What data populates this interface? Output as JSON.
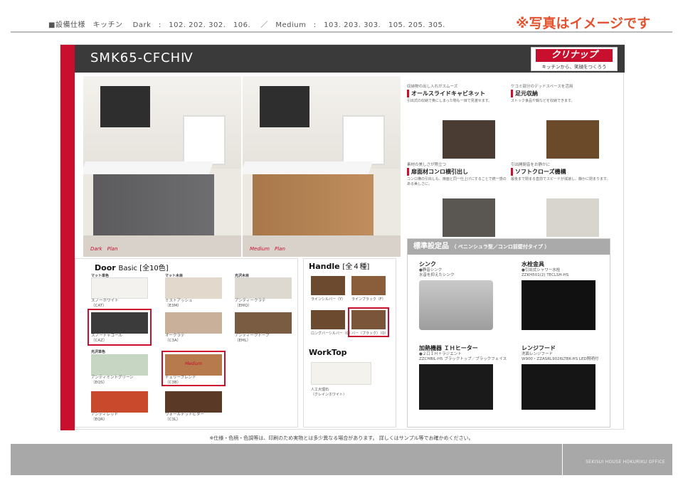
{
  "header": {
    "spec": "■設備仕様　キッチン　 Dark　:　102. 202. 302.　106.　 ／　Medium　:　103. 203. 303.　105. 205. 305.",
    "note": "※写真はイメージです"
  },
  "sheet": {
    "title": "SMK65-CFCHⅣ",
    "logo_text": "クリナップ",
    "logo_tagline": "キッチンから、笑顔をつくろう",
    "plan_dark": "Dark　Plan",
    "plan_medium": "Medium　Plan"
  },
  "features": [
    {
      "tag": "収納物の出し入れがスムーズ",
      "title": "オールスライドキャビネット",
      "desc": "引出式の収納で奥にしまった物も一目で見渡せます。"
    },
    {
      "tag": "ケコミ部分のデッドスペースを活用",
      "title": "足元収納",
      "desc": "ストック食品や鍋などを収納できます。"
    },
    {
      "tag": "素材の美しさが際立つ",
      "title": "扉面材コンロ横引出し",
      "desc": "コンロ横の引出しも、扉面と同一仕上げにすることで統一感のある美しさに。"
    },
    {
      "tag": "引出開閉音をお静かに",
      "title": "ソフトクローズ機構",
      "desc": "最後まで閉まる直前でスピードが減速し、静かに閉まります。"
    }
  ],
  "standard": {
    "heading": "標準設定品",
    "subheading": "（ ペニンシュラ型／コンロ前壁付タイプ ）",
    "sink": {
      "title": "シンク",
      "name": "●静音シンク",
      "desc": "水音を抑えたシンク"
    },
    "faucet": {
      "title": "水栓金具",
      "name": "●引出式シャワー水栓",
      "desc": "ZZKH501(2) TECLSH-HS"
    },
    "heater": {
      "title": "加熱機器 ＩＨヒーター",
      "name": "●２口ＩＨ＋ラジエント",
      "desc": "ZZCHBIL-H5 ブラックトップ／ブラックフェイス"
    },
    "hood": {
      "title": "レンジフード",
      "name": "洗面レンジフード",
      "desc": "W900・ZZASRL9026LTBK-HS LED照明付"
    }
  },
  "door": {
    "heading": "Door",
    "basic": "Basic [全10色]",
    "group_matte": "マット単色",
    "group_matte_wood": "マット木目",
    "group_gloss_wood": "光沢木目",
    "group_gloss": "光沢単色",
    "medium_label": "Medium",
    "swatches": [
      {
        "label": "スノーホワイト",
        "code": "（CAT）",
        "color": "#f3f2ef"
      },
      {
        "label": "ミストアッシュ",
        "code": "（E3M）",
        "color": "#e2d8cc"
      },
      {
        "label": "アンティークラテ",
        "code": "（EMQ）",
        "color": "#ddd8d0"
      },
      {
        "label": "スノーチャコール",
        "code": "（CAZ）",
        "color": "#3c3b3c"
      },
      {
        "label": "オークラテ",
        "code": "（C3A）",
        "color": "#c8b09a"
      },
      {
        "label": "アンティークトープ",
        "code": "（EML）",
        "color": "#7a5c42"
      },
      {
        "label": "アンティミントグリーン",
        "code": "（EQS）",
        "color": "#c6d6c3"
      },
      {
        "label": "チェリーブレンド",
        "code": "（C3B）",
        "color": "#b67a4c"
      },
      {
        "label": "アンティレッド",
        "code": "（EQR）",
        "color": "#c9492c"
      },
      {
        "label": "ウォールナットビター",
        "code": "（C3L）",
        "color": "#5a3a26"
      }
    ]
  },
  "handle": {
    "heading": "Handle",
    "count": "[全４種]",
    "items": [
      "ラインシルバー（Y）",
      "ラインブラック（F）",
      "ロングバーシルバー（C）",
      "バー（ブラック）（Q）"
    ]
  },
  "worktop": {
    "heading": "WorkTop",
    "label": "人工大理石",
    "sub": "（グレインホワイト）"
  },
  "footnote": "※仕様・色柄・色調等は、印刷のため実物とは多少異なる場合があります。 詳しくはサンプル等でお確かめください。",
  "footer": {
    "org": "SEKISUI HOUSE HOKURIKU OFFICE"
  }
}
